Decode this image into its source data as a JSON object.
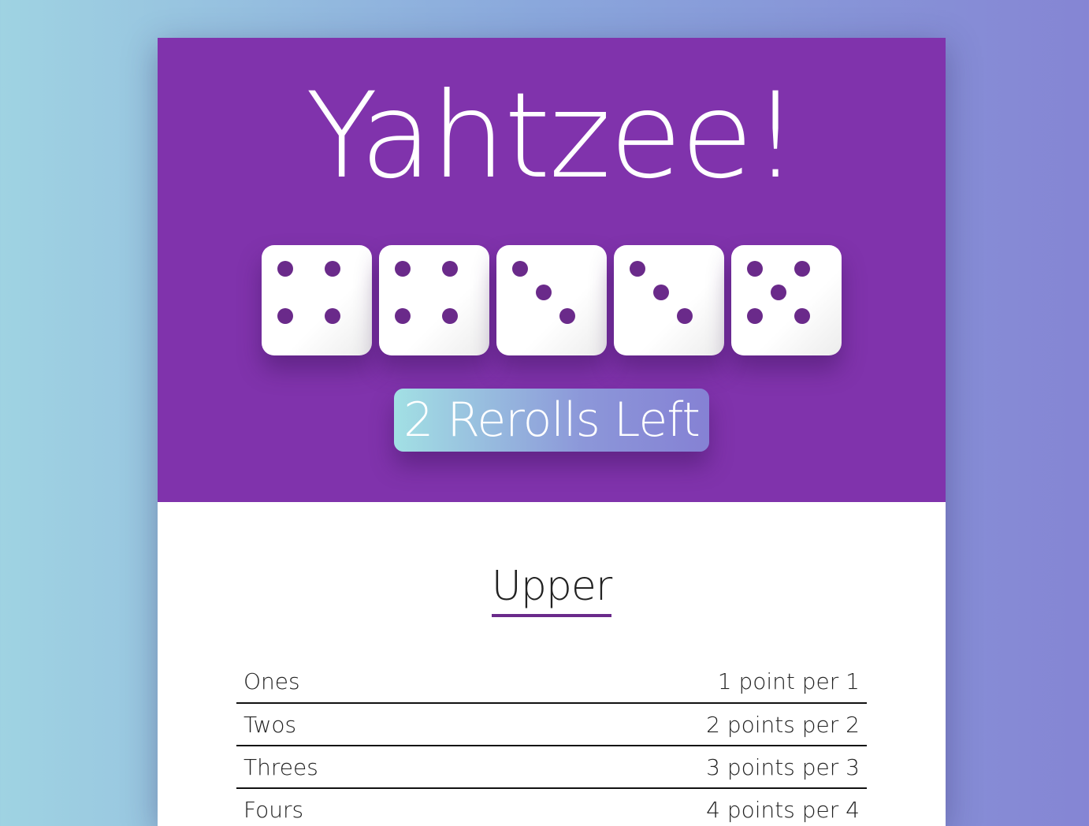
{
  "game": {
    "title": "Yahtzee!",
    "dice": [
      {
        "value": 4
      },
      {
        "value": 4
      },
      {
        "value": 3
      },
      {
        "value": 3
      },
      {
        "value": 5
      }
    ],
    "reroll_button": "2 Rerolls Left"
  },
  "upper": {
    "heading": "Upper",
    "rules": [
      {
        "name": "Ones",
        "description": "1 point per 1"
      },
      {
        "name": "Twos",
        "description": "2 points per 2"
      },
      {
        "name": "Threes",
        "description": "3 points per 3"
      },
      {
        "name": "Fours",
        "description": "4 points per 4"
      }
    ]
  },
  "colors": {
    "header_bg": "#8033ac",
    "pip": "#6a2a8a",
    "accent": "#6a2a8a"
  }
}
